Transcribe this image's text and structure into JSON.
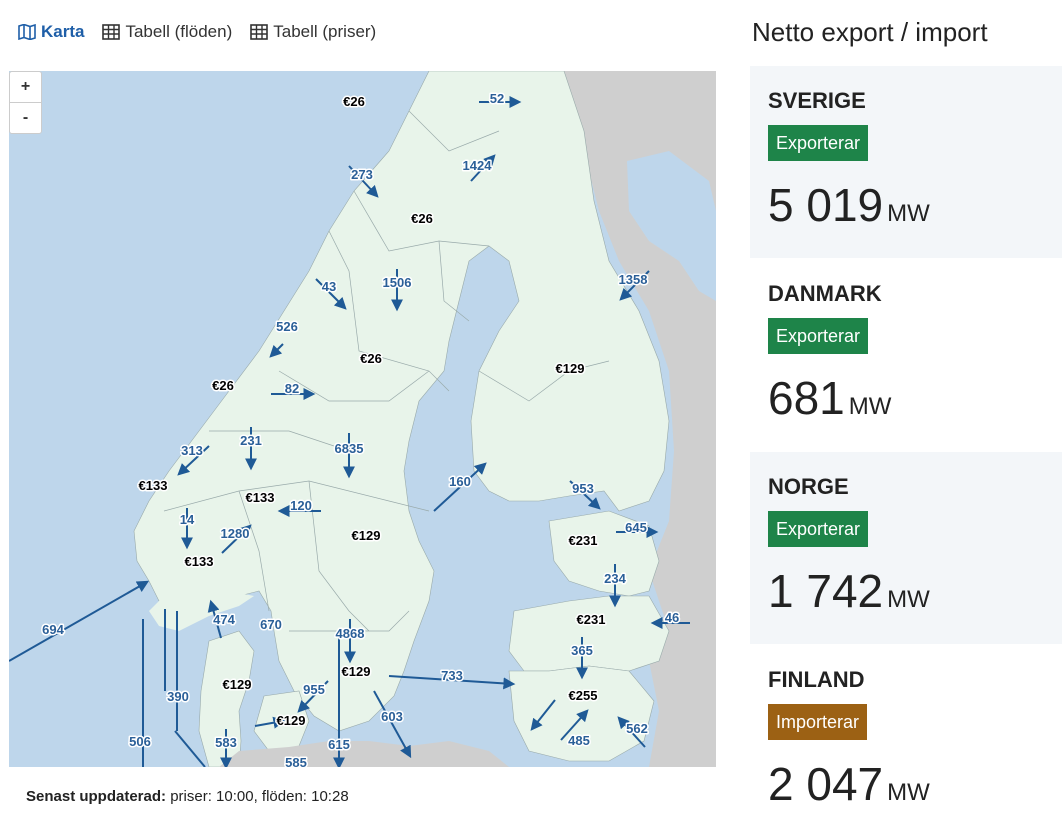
{
  "tabs": [
    {
      "label": "Karta",
      "icon": "map-icon",
      "active": true
    },
    {
      "label": "Tabell (flöden)",
      "icon": "table-icon",
      "active": false
    },
    {
      "label": "Tabell (priser)",
      "icon": "table-icon",
      "active": false
    }
  ],
  "zoom": {
    "in": "+",
    "out": "-"
  },
  "map": {
    "prices": [
      {
        "id": "no4-north",
        "text": "€26"
      },
      {
        "id": "se1",
        "text": "€26"
      },
      {
        "id": "se2",
        "text": "€26"
      },
      {
        "id": "no3",
        "text": "€26"
      },
      {
        "id": "fi",
        "text": "€129"
      },
      {
        "id": "no5",
        "text": "€133"
      },
      {
        "id": "no1",
        "text": "€133"
      },
      {
        "id": "no2",
        "text": "€133"
      },
      {
        "id": "se3",
        "text": "€129"
      },
      {
        "id": "ee",
        "text": "€231"
      },
      {
        "id": "lv",
        "text": "€231"
      },
      {
        "id": "lt",
        "text": "€255"
      },
      {
        "id": "dk1",
        "text": "€129"
      },
      {
        "id": "se4",
        "text": "€129"
      },
      {
        "id": "dk2",
        "text": "€129"
      }
    ],
    "flows": [
      {
        "id": "f1",
        "text": "52"
      },
      {
        "id": "f2",
        "text": "1424"
      },
      {
        "id": "f3",
        "text": "273"
      },
      {
        "id": "f4",
        "text": "1358"
      },
      {
        "id": "f5",
        "text": "43"
      },
      {
        "id": "f6",
        "text": "1506"
      },
      {
        "id": "f7",
        "text": "526"
      },
      {
        "id": "f8",
        "text": "82"
      },
      {
        "id": "f9",
        "text": "313"
      },
      {
        "id": "f10",
        "text": "231"
      },
      {
        "id": "f11",
        "text": "6835"
      },
      {
        "id": "f12",
        "text": "160"
      },
      {
        "id": "f13",
        "text": "953"
      },
      {
        "id": "f14",
        "text": "645"
      },
      {
        "id": "f15",
        "text": "120"
      },
      {
        "id": "f16",
        "text": "14"
      },
      {
        "id": "f17",
        "text": "1280"
      },
      {
        "id": "f18",
        "text": "234"
      },
      {
        "id": "f19",
        "text": "694"
      },
      {
        "id": "f20",
        "text": "474"
      },
      {
        "id": "f21",
        "text": "670"
      },
      {
        "id": "f22",
        "text": "4868"
      },
      {
        "id": "f23",
        "text": "46"
      },
      {
        "id": "f24",
        "text": "365"
      },
      {
        "id": "f25",
        "text": "390"
      },
      {
        "id": "f26",
        "text": "955"
      },
      {
        "id": "f27",
        "text": "733"
      },
      {
        "id": "f28",
        "text": "603"
      },
      {
        "id": "f29",
        "text": "506"
      },
      {
        "id": "f30",
        "text": "583"
      },
      {
        "id": "f31",
        "text": "615"
      },
      {
        "id": "f32",
        "text": "485"
      },
      {
        "id": "f33",
        "text": "562"
      },
      {
        "id": "f34",
        "text": "585"
      }
    ]
  },
  "footer": {
    "label": "Senast uppdaterad:",
    "text": "priser: 10:00, flöden: 10:28"
  },
  "panel": {
    "title": "Netto export / import",
    "cards": [
      {
        "country": "SVERIGE",
        "status": "Exporterar",
        "status_color": "#1e8449",
        "value": "5 019",
        "unit": "MW"
      },
      {
        "country": "DANMARK",
        "status": "Exporterar",
        "status_color": "#1e8449",
        "value": "681",
        "unit": "MW"
      },
      {
        "country": "NORGE",
        "status": "Exporterar",
        "status_color": "#1e8449",
        "value": "1 742",
        "unit": "MW"
      },
      {
        "country": "FINLAND",
        "status": "Importerar",
        "status_color": "#9c6114",
        "value": "2 047",
        "unit": "MW"
      }
    ]
  },
  "colors": {
    "sea": "#bed6eb",
    "land": "#e8f4ea",
    "other_land": "#cfcfcf",
    "flow": "#1f5a96",
    "accent": "#1f5fa8"
  }
}
